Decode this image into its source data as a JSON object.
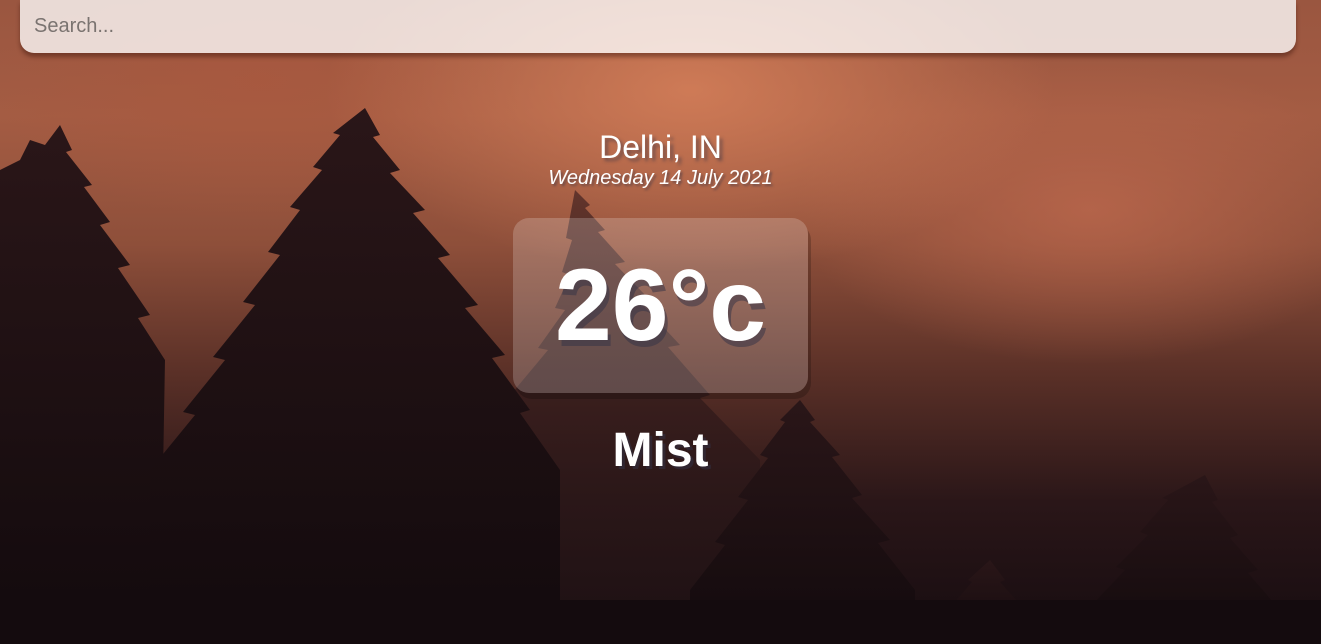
{
  "search": {
    "placeholder": "Search...",
    "value": ""
  },
  "location": {
    "city": "Delhi, IN",
    "date": "Wednesday 14 July 2021"
  },
  "weather": {
    "temperature": "26°c",
    "condition": "Mist"
  },
  "colors": {
    "text": "#ffffff",
    "search_background": "#f1ddd6",
    "sky_orange": "#b8694c",
    "forest_dark": "#160c10"
  },
  "background": {
    "scene": "misty-forest-sunset"
  }
}
